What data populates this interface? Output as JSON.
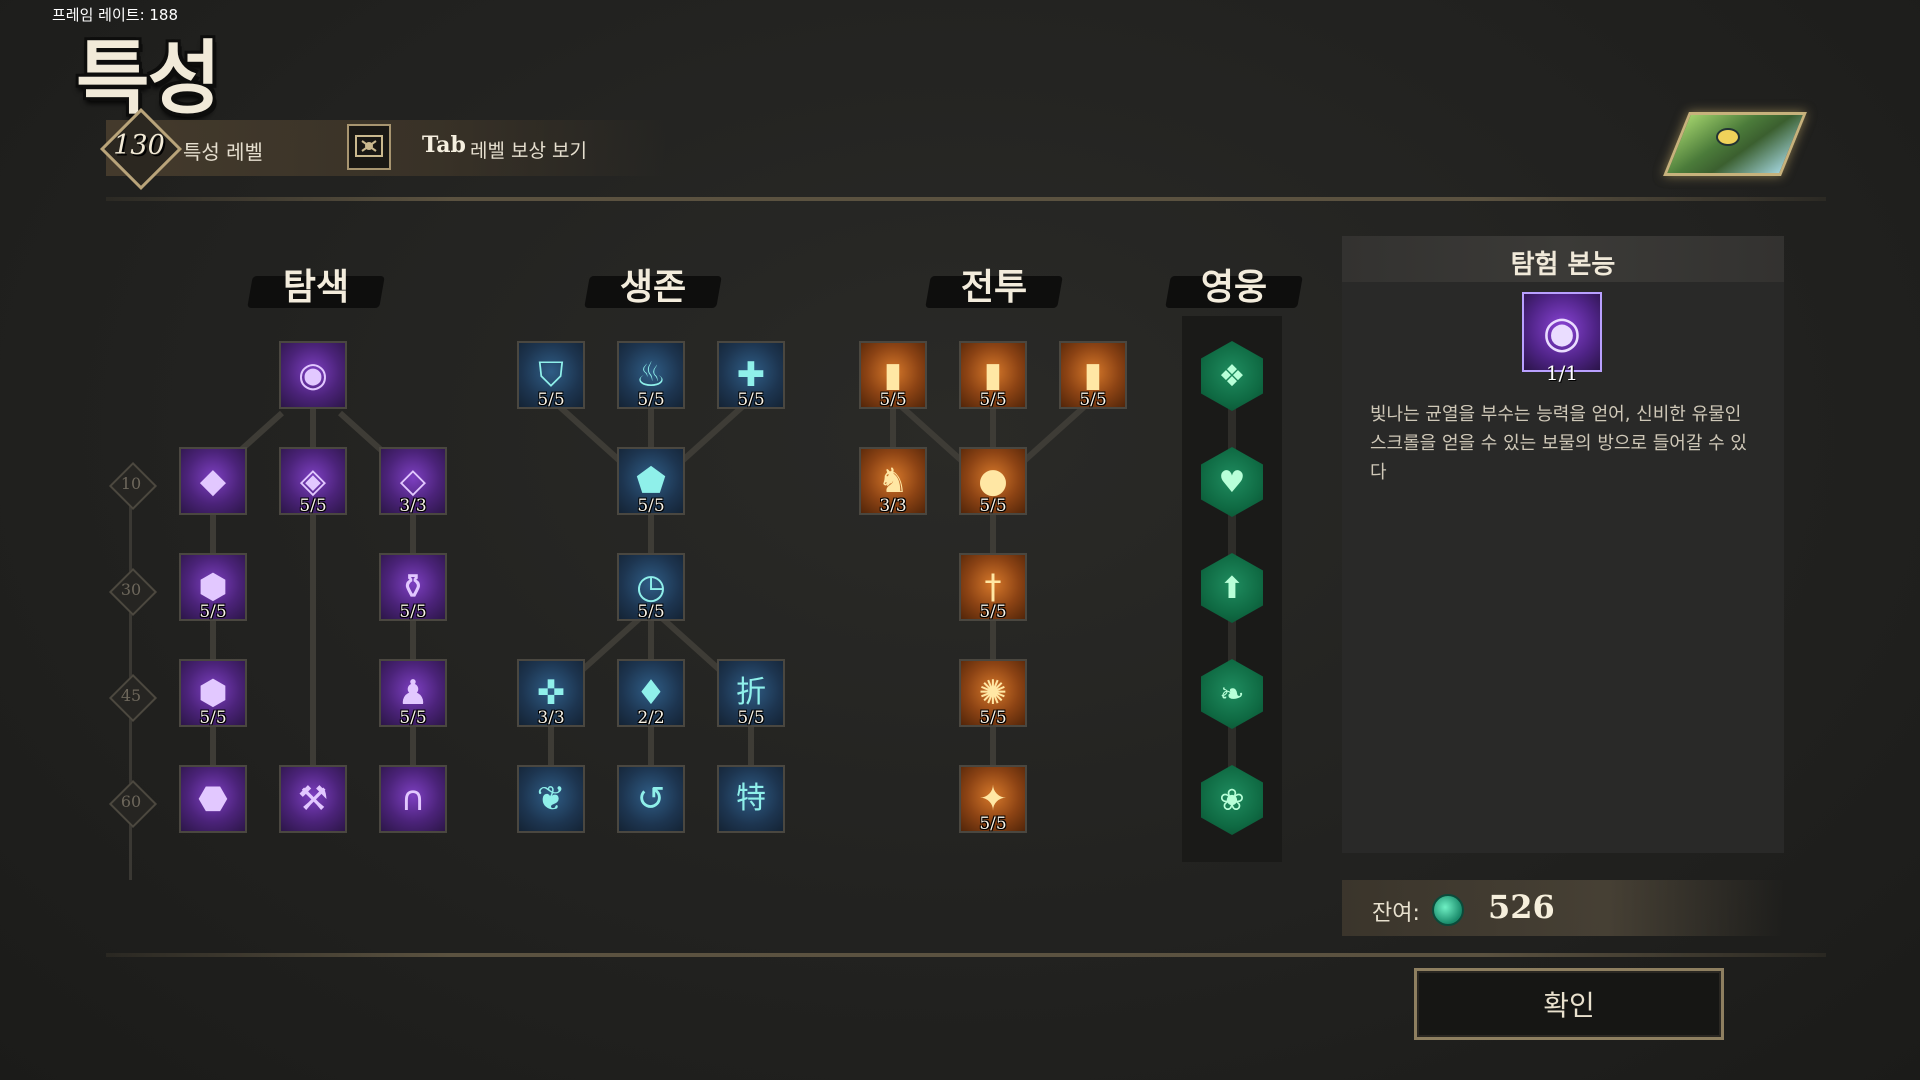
{
  "hud": {
    "frame_rate": "프레임 레이트: 188"
  },
  "header": {
    "title": "특성",
    "trait_level_value": "130",
    "trait_level_label": "특성 레벨",
    "tab_key": "Tab",
    "tab_desc": "레벨 보상 보기"
  },
  "categories": {
    "exploration": "탐색",
    "survival": "생존",
    "combat": "전투",
    "hero": "영웅"
  },
  "level_markers": [
    "10",
    "30",
    "45",
    "60"
  ],
  "nodes": {
    "exploration": {
      "root": "",
      "r1c1": "",
      "r1c2": "5/5",
      "r1c3": "3/3",
      "r2c1": "5/5",
      "r2c3": "5/5",
      "r3c1": "5/5",
      "r3c3": "5/5",
      "r4c1": "",
      "r4c2": "",
      "r4c3": ""
    },
    "survival": {
      "r0c1": "5/5",
      "r0c2": "5/5",
      "r0c3": "5/5",
      "r1c2": "5/5",
      "r2c2": "5/5",
      "r3c1": "3/3",
      "r3c2": "2/2",
      "r3c3": "5/5",
      "r4c1": "",
      "r4c2": "",
      "r4c3": ""
    },
    "combat": {
      "r0c1": "5/5",
      "r0c2": "5/5",
      "r0c3": "5/5",
      "r1c1": "3/3",
      "r1c2": "5/5",
      "r2c2": "5/5",
      "r3c2": "5/5",
      "r4c2": "5/5"
    }
  },
  "detail": {
    "title": "탐험 본능",
    "count": "1/1",
    "description": "빛나는 균열을 부수는 능력을 얻어, 신비한 유물인 스크롤을 얻을 수 있는 보물의 방으로 들어갈 수 있다"
  },
  "footer": {
    "remaining_label": "잔여:",
    "remaining_value": "526",
    "confirm_label": "확인"
  },
  "colors": {
    "exploration": "#6a32a8",
    "survival": "#2a4f72",
    "combat": "#b8621f",
    "hero": "#13774b"
  },
  "icons": {
    "coin": "teal-gem-icon",
    "tab_key": "scroll-reward-icon",
    "hero_portrait": "hero-portrait-icon"
  }
}
